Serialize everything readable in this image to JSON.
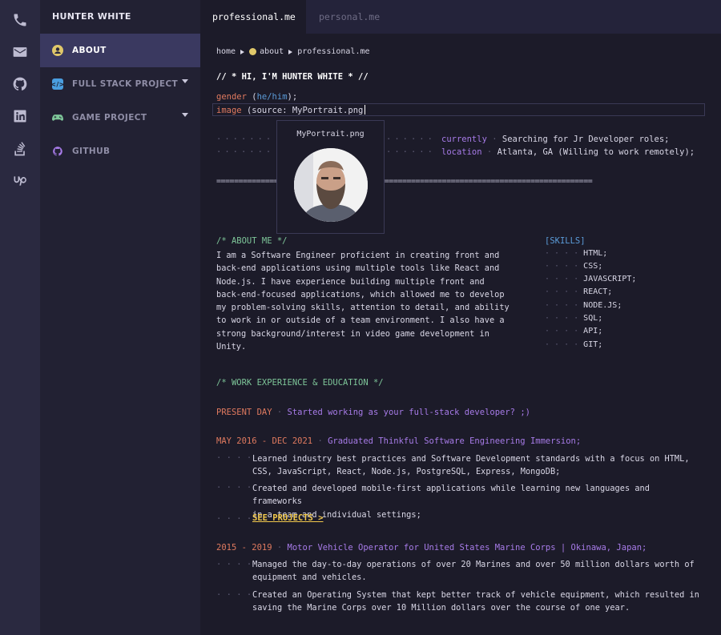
{
  "activity_bar": {
    "icons": [
      "phone-icon",
      "mail-icon",
      "github-icon",
      "linkedin-icon",
      "stackoverflow-icon",
      "upwork-icon"
    ]
  },
  "sidebar": {
    "title": "HUNTER WHITE",
    "items": [
      {
        "label": "ABOUT",
        "icon": "face-icon",
        "active": true
      },
      {
        "label": "FULL STACK PROJECT",
        "icon": "code-icon",
        "expandable": true
      },
      {
        "label": "GAME PROJECT",
        "icon": "gamepad-icon",
        "expandable": true
      },
      {
        "label": "GITHUB",
        "icon": "github-icon"
      }
    ]
  },
  "tabs": [
    {
      "label": "professional.me",
      "active": true
    },
    {
      "label": "personal.me",
      "active": false
    }
  ],
  "breadcrumb": {
    "home": "home",
    "about": "about",
    "file": "professional.me"
  },
  "greeting": "// * HI, I'M HUNTER WHITE * //",
  "fields": {
    "gender_key": "gender",
    "gender_value": "he/him",
    "image_key": "image",
    "image_value": "(source: MyPortrait.png"
  },
  "popup": {
    "filename": "MyPortrait.png"
  },
  "status": {
    "currently_key": "currently",
    "currently_value": "Searching for Jr Developer roles;",
    "location_key": "location",
    "location_value": "Atlanta, GA (Willing to work remotely);"
  },
  "divider": "=====================================================================================",
  "about": {
    "heading": "/* ABOUT ME */",
    "lines": [
      "I am a Software Engineer proficient in creating front and",
      "back-end applications using multiple tools like React and",
      "Node.js. I have experience building multiple front and",
      "back-end-focused applications, which allowed me to develop",
      "my problem-solving skills, attention to detail, and ability",
      "to work in or outside of a team environment. I also have a",
      "strong background/interest in video game development in",
      "Unity."
    ]
  },
  "skills": {
    "heading": "[SKILLS]",
    "items": [
      "HTML;",
      "CSS;",
      "JAVASCRIPT;",
      "REACT;",
      "NODE.JS;",
      "SQL;",
      "API;",
      "GIT;"
    ]
  },
  "work": {
    "heading": "/* WORK EXPERIENCE & EDUCATION */",
    "present_date": "PRESENT DAY",
    "present_text": "Started working as your full-stack developer? ;)",
    "job1_date": "MAY 2016 - DEC 2021",
    "job1_title": "Graduated Thinkful Software Engineering Immersion;",
    "job1_b1_l1": "Learned industry best practices and Software Development standards with a focus on HTML,",
    "job1_b1_l2": "CSS, JavaScript, React, Node.js, PostgreSQL, Express, MongoDB;",
    "job1_b2_l1": "Created and developed mobile-first applications while learning new languages and frameworks",
    "job1_b2_l2": "in a team and individual settings;",
    "see_projects": "SEE PROJECTS >",
    "job2_date": "2015 - 2019",
    "job2_title": "Motor Vehicle Operator for United States Marine Corps | Okinawa, Japan;",
    "job2_b1_l1": "Managed the day-to-day operations of over 20 Marines and over 50 million dollars worth of",
    "job2_b1_l2": "equipment and vehicles.",
    "job2_b2_l1": "Created an Operating System that kept better track of vehicle equipment, which resulted in",
    "job2_b2_l2": "saving the Marine Corps over 10 Million dollars over the course of one year."
  }
}
